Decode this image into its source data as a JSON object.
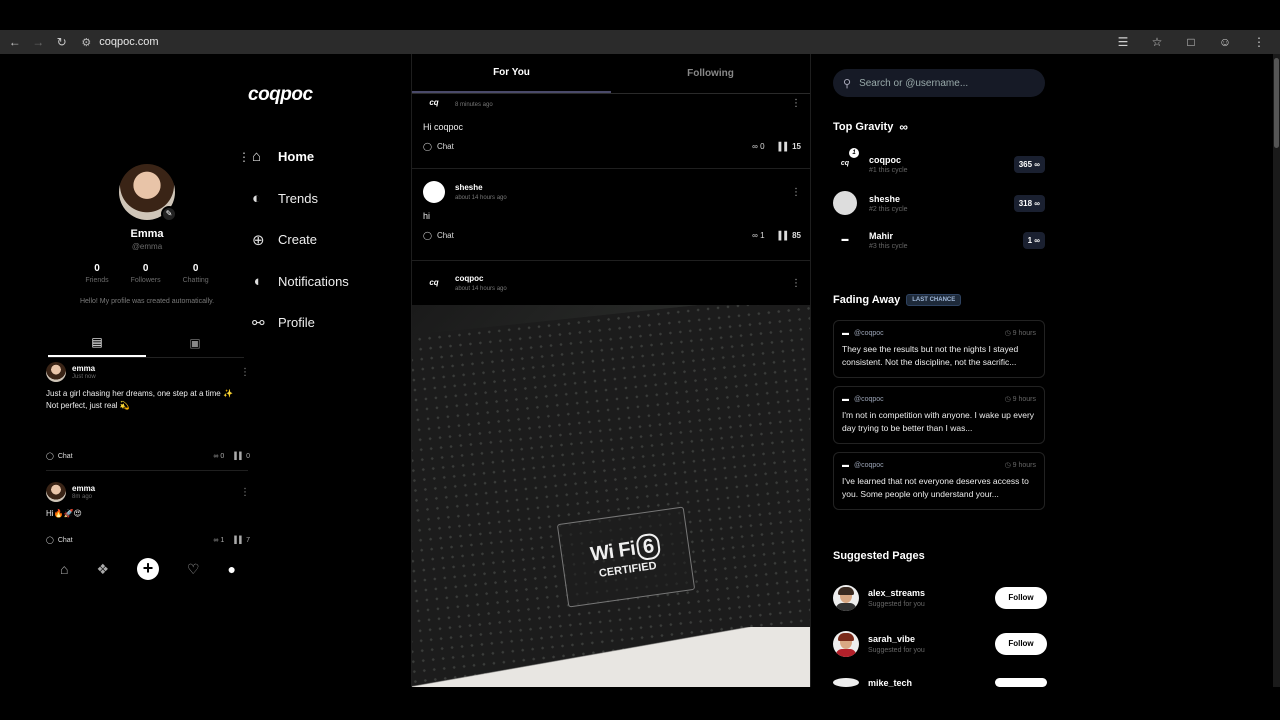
{
  "browser": {
    "url": "coqpoc.com"
  },
  "app": {
    "logo": "coqpoc"
  },
  "profile": {
    "name": "Emma",
    "username": "@emma",
    "stats": [
      {
        "value": "0",
        "label": "Friends"
      },
      {
        "value": "0",
        "label": "Followers"
      },
      {
        "value": "0",
        "label": "Chatting"
      }
    ],
    "bio": "Hello! My profile was created automatically."
  },
  "left_posts": [
    {
      "user": "emma",
      "time": "Just now",
      "text": "Just a girl chasing her dreams, one step at a time ✨\nNot perfect, just real 💫",
      "chat": "Chat",
      "infinity": "0",
      "views": "0"
    },
    {
      "user": "emma",
      "time": "8m ago",
      "text": "Hi🔥🚀😍",
      "chat": "Chat",
      "infinity": "1",
      "views": "7"
    }
  ],
  "nav": {
    "items": [
      {
        "label": "Home"
      },
      {
        "label": "Trends"
      },
      {
        "label": "Create"
      },
      {
        "label": "Notifications"
      },
      {
        "label": "Profile"
      }
    ]
  },
  "feed": {
    "tabs": [
      "For You",
      "Following"
    ],
    "posts": [
      {
        "user": "",
        "time": "8 minutes ago",
        "text": "Hi coqpoc",
        "chat": "Chat",
        "infinity": "0",
        "views": "15"
      },
      {
        "user": "sheshe",
        "time": "about 14 hours ago",
        "text": "hi",
        "chat": "Chat",
        "infinity": "1",
        "views": "85"
      },
      {
        "user": "coqpoc",
        "time": "about 14 hours ago"
      }
    ],
    "photo": {
      "badge_wifi": "Wi Fi",
      "badge_num": "6",
      "badge_cert": "CERTIFIED"
    }
  },
  "right": {
    "search_placeholder": "Search or @username...",
    "top_gravity_title": "Top Gravity",
    "top_gravity": [
      {
        "name": "coqpoc",
        "rank": "#1 this cycle",
        "score": "365 ∞"
      },
      {
        "name": "sheshe",
        "rank": "#2 this cycle",
        "score": "318 ∞"
      },
      {
        "name": "Mahir",
        "rank": "#3 this cycle",
        "score": "1 ∞"
      }
    ],
    "fading_title": "Fading Away",
    "fading_badge": "LAST CHANCE",
    "fading": [
      {
        "user": "@coqpoc",
        "time": "9 hours",
        "text": "They see the results but not the nights I stayed consistent. Not the discipline, not the sacrific..."
      },
      {
        "user": "@coqpoc",
        "time": "9 hours",
        "text": "I'm not in competition with anyone. I wake up every day trying to be better than I was..."
      },
      {
        "user": "@coqpoc",
        "time": "9 hours",
        "text": "I've learned that not everyone deserves access to you. Some people only understand your..."
      }
    ],
    "suggested_title": "Suggested Pages",
    "suggested": [
      {
        "name": "alex_streams",
        "sub": "Suggested for you",
        "button": "Follow"
      },
      {
        "name": "sarah_vibe",
        "sub": "Suggested for you",
        "button": "Follow"
      },
      {
        "name": "mike_tech"
      }
    ]
  }
}
